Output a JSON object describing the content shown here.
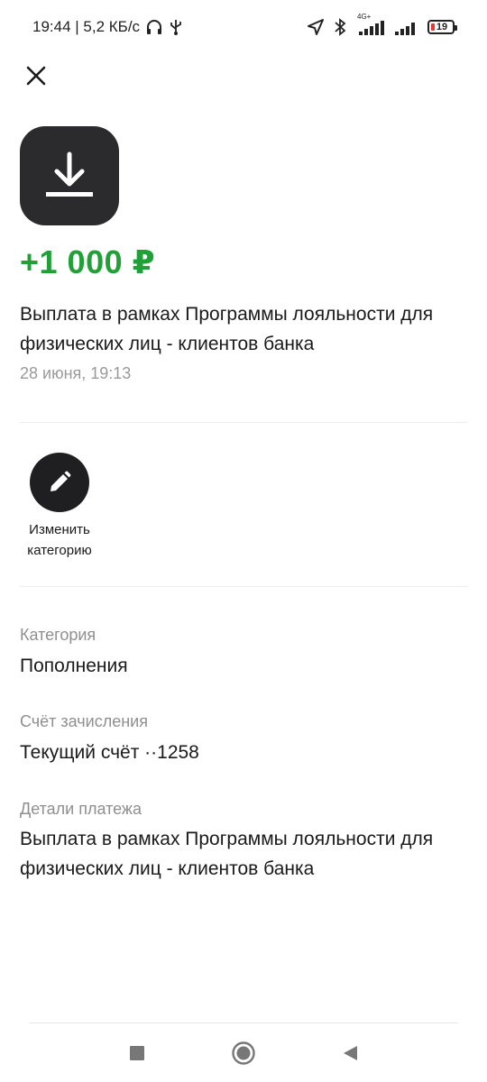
{
  "status_bar": {
    "time_speed": "19:44 | 5,2 КБ/с",
    "network_label": "4G+",
    "battery": "19",
    "icons": [
      "headphones-icon",
      "usb-icon",
      "location-icon",
      "bluetooth-icon",
      "signal-icon",
      "signal-icon",
      "battery-icon"
    ],
    "battery_low_color": "#e53935"
  },
  "header": {
    "close_icon": "close-icon"
  },
  "transaction": {
    "icon": "download-icon",
    "amount": "+1 000 ₽",
    "amount_color": "#21a038",
    "description": "Выплата в рамках Программы лояльности для физических лиц - клиентов банка",
    "date": "28 июня, 19:13"
  },
  "actions": [
    {
      "icon": "pencil-icon",
      "label": "Изменить\nкатегорию"
    }
  ],
  "details": {
    "category_label": "Категория",
    "category_value": "Пополнения",
    "account_label": "Счёт зачисления",
    "account_value": "Текущий счёт ··1258",
    "payment_details_label": "Детали платежа",
    "payment_details_value": "Выплата в рамках Программы лояльности для физических лиц - клиентов банка"
  },
  "nav_bar": {
    "icons": [
      "square-icon",
      "home-circle-icon",
      "back-triangle-icon"
    ]
  }
}
